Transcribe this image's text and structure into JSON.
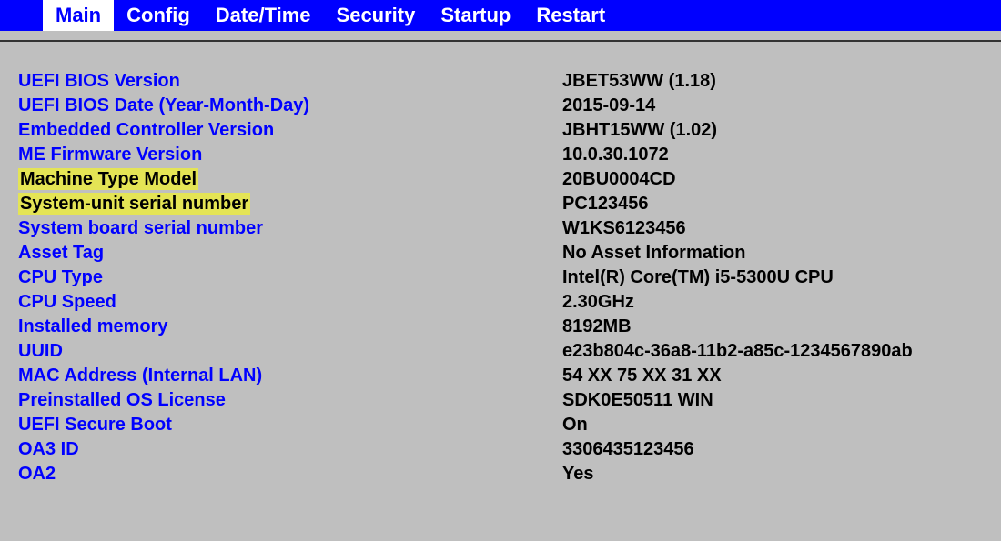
{
  "menu": {
    "tabs": [
      {
        "label": "Main",
        "active": true
      },
      {
        "label": "Config",
        "active": false
      },
      {
        "label": "Date/Time",
        "active": false
      },
      {
        "label": "Security",
        "active": false
      },
      {
        "label": "Startup",
        "active": false
      },
      {
        "label": "Restart",
        "active": false
      }
    ]
  },
  "info": [
    {
      "label": "UEFI BIOS Version",
      "value": "JBET53WW (1.18)",
      "highlight": false
    },
    {
      "label": "UEFI BIOS Date (Year-Month-Day)",
      "value": "2015-09-14",
      "highlight": false
    },
    {
      "label": "Embedded Controller Version",
      "value": "JBHT15WW (1.02)",
      "highlight": false
    },
    {
      "label": "ME Firmware Version",
      "value": "10.0.30.1072",
      "highlight": false
    },
    {
      "label": "Machine Type Model",
      "value": "20BU0004CD",
      "highlight": true
    },
    {
      "label": "System-unit serial number",
      "value": "PC123456",
      "highlight": true
    },
    {
      "label": "System board serial number",
      "value": "W1KS6123456",
      "highlight": false
    },
    {
      "label": "Asset Tag",
      "value": "No Asset Information",
      "highlight": false
    },
    {
      "label": "CPU Type",
      "value": "Intel(R) Core(TM) i5-5300U CPU",
      "highlight": false
    },
    {
      "label": "CPU Speed",
      "value": "2.30GHz",
      "highlight": false
    },
    {
      "label": "Installed memory",
      "value": "8192MB",
      "highlight": false
    },
    {
      "label": "UUID",
      "value": "e23b804c-36a8-11b2-a85c-1234567890ab",
      "highlight": false
    },
    {
      "label": "MAC Address (Internal LAN)",
      "value": "54 XX 75 XX 31 XX",
      "highlight": false
    },
    {
      "label": "Preinstalled OS License",
      "value": "SDK0E50511 WIN",
      "highlight": false
    },
    {
      "label": "UEFI Secure Boot",
      "value": "On",
      "highlight": false
    },
    {
      "label": "OA3 ID",
      "value": "3306435123456",
      "highlight": false
    },
    {
      "label": "OA2",
      "value": "Yes",
      "highlight": false
    }
  ]
}
